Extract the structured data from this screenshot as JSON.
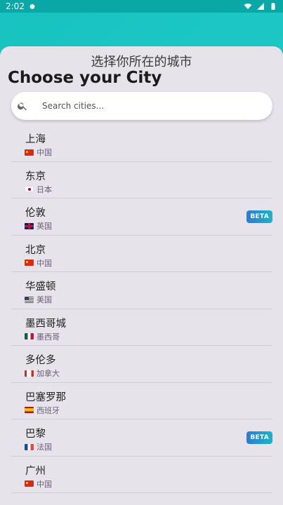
{
  "status": {
    "time": "2:02"
  },
  "subtitle": "选择你所在的城市",
  "title": "Choose your City",
  "search": {
    "placeholder": "Search cities..."
  },
  "cities": [
    {
      "name": "上海",
      "country": "中国",
      "flag": "cn",
      "beta": ""
    },
    {
      "name": "东京",
      "country": "日本",
      "flag": "jp",
      "beta": ""
    },
    {
      "name": "伦敦",
      "country": "英国",
      "flag": "gb",
      "beta": "BETA"
    },
    {
      "name": "北京",
      "country": "中国",
      "flag": "cn",
      "beta": ""
    },
    {
      "name": "华盛顿",
      "country": "美国",
      "flag": "us",
      "beta": ""
    },
    {
      "name": "墨西哥城",
      "country": "墨西哥",
      "flag": "mx",
      "beta": ""
    },
    {
      "name": "多伦多",
      "country": "加拿大",
      "flag": "ca",
      "beta": ""
    },
    {
      "name": "巴塞罗那",
      "country": "西班牙",
      "flag": "es",
      "beta": ""
    },
    {
      "name": "巴黎",
      "country": "法国",
      "flag": "fr",
      "beta": "BETA"
    },
    {
      "name": "广州",
      "country": "中国",
      "flag": "cn",
      "beta": ""
    }
  ],
  "colors": {
    "accent": "#1ec8c8",
    "sheet": "#e7e3ea",
    "beta_start": "#2b7bd6",
    "beta_end": "#18b7c7"
  }
}
